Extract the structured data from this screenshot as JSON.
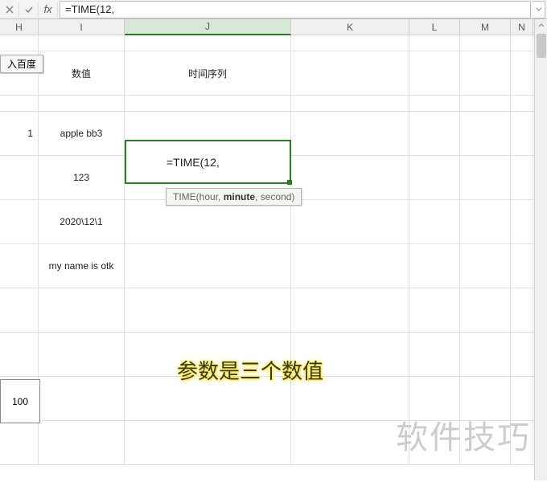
{
  "formula_bar": {
    "cancel": "✕",
    "confirm": "✓",
    "fx": "fx",
    "value": "=TIME(12,"
  },
  "columns": [
    "H",
    "I",
    "J",
    "K",
    "L",
    "M",
    "N"
  ],
  "widths": [
    48,
    107,
    207,
    147,
    63,
    63,
    28
  ],
  "active_col_index": 2,
  "rows": {
    "header_i": "数值",
    "header_j": "时间序列",
    "r1_num": "1",
    "r1_i": "apple bb3",
    "r1_j": "=TIME(12,",
    "r2_i": "123",
    "r3_i": "2020\\12\\1",
    "r4_i": "my name is otk",
    "r5_box": "100"
  },
  "tooltip": {
    "fn": "TIME",
    "arg1": "hour",
    "arg2": "minute",
    "arg3": "second"
  },
  "button_baidu": "入百度",
  "annotation": "参数是三个数值",
  "watermark": "软件技巧"
}
